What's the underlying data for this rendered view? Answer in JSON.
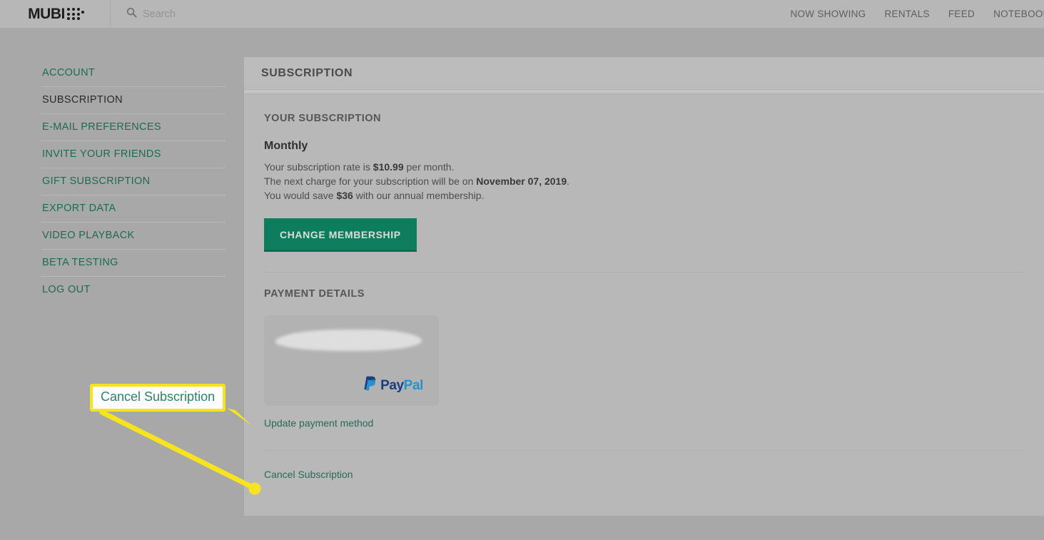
{
  "header": {
    "logo_word": "MUBI",
    "logo_icon": "mubi-dots-logo",
    "search": {
      "icon": "search-icon",
      "placeholder": "Search",
      "value": ""
    },
    "nav": [
      {
        "label": "NOW SHOWING"
      },
      {
        "label": "RENTALS"
      },
      {
        "label": "FEED"
      },
      {
        "label": "NOTEBOOK"
      }
    ]
  },
  "sidebar": {
    "items": [
      {
        "label": "ACCOUNT",
        "active": false
      },
      {
        "label": "SUBSCRIPTION",
        "active": true
      },
      {
        "label": "E-MAIL PREFERENCES",
        "active": false
      },
      {
        "label": "INVITE YOUR FRIENDS",
        "active": false
      },
      {
        "label": "GIFT SUBSCRIPTION",
        "active": false
      },
      {
        "label": "EXPORT DATA",
        "active": false
      },
      {
        "label": "VIDEO PLAYBACK",
        "active": false
      },
      {
        "label": "BETA TESTING",
        "active": false
      },
      {
        "label": "LOG OUT",
        "active": false
      }
    ]
  },
  "panel": {
    "title": "SUBSCRIPTION",
    "subscription": {
      "section_heading": "YOUR SUBSCRIPTION",
      "plan_name": "Monthly",
      "rate_prefix": "Your subscription rate is ",
      "rate_amount": "$10.99",
      "rate_suffix": " per month.",
      "next_charge_prefix": "The next charge for your subscription will be on ",
      "next_charge_date": "November 07, 2019",
      "next_charge_suffix": ".",
      "save_prefix": "You would save ",
      "save_amount": "$36",
      "save_suffix": " with our annual membership.",
      "change_button": "CHANGE MEMBERSHIP"
    },
    "payment": {
      "section_heading": "PAYMENT DETAILS",
      "card_provider": "PayPal",
      "card_provider_part1": "Pay",
      "card_provider_part2": "Pal",
      "card_redacted": true,
      "update_link": "Update payment method",
      "cancel_link": "Cancel Subscription"
    }
  },
  "annotation": {
    "callout_text": "Cancel Subscription",
    "border_color": "#f7e41c",
    "pointer_color": "#f7e41c",
    "dot_color": "#f7e41c",
    "text_color": "#2d8566"
  },
  "colors": {
    "page_background": "#a8a8a9",
    "header_background": "#b7b7b7",
    "panel_background": "#b8b8b9",
    "accent_green": "#0e7d5d",
    "link_green": "#1b6b52",
    "paypal_dark": "#193e7e",
    "paypal_light": "#2591cf"
  }
}
